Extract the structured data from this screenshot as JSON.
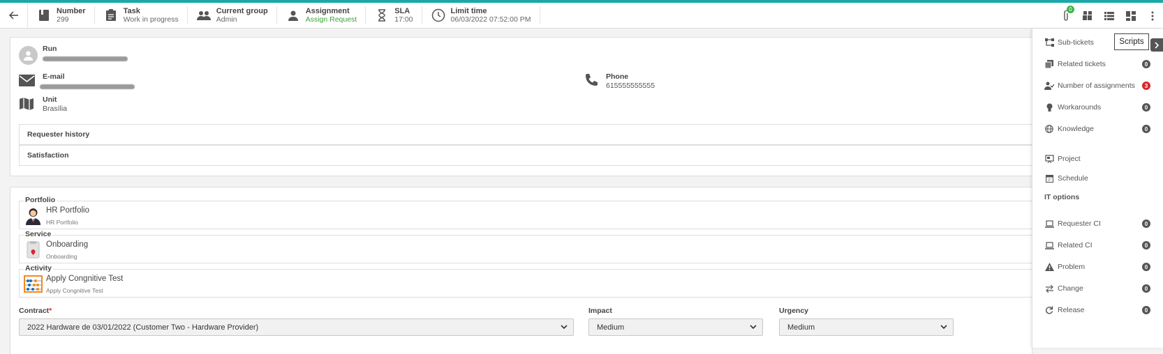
{
  "header": {
    "number_label": "Number",
    "number_value": "299",
    "task_label": "Task",
    "task_value": "Work in progress",
    "group_label": "Current group",
    "group_value": "Admin",
    "assignment_label": "Assignment",
    "assignment_value": "Assign Request",
    "sla_label": "SLA",
    "sla_value": "17:00",
    "limit_label": "Limit time",
    "limit_value": "06/03/2022 07:52:00 PM",
    "attachment_count": "0"
  },
  "requester": {
    "run_label": "Run",
    "email_label": "E-mail",
    "phone_label": "Phone",
    "phone_value": "615555555555",
    "unit_label": "Unit",
    "unit_value": "Brasília",
    "history_label": "Requester history",
    "satisfaction_label": "Satisfaction"
  },
  "catalog": {
    "portfolio_label": "Portfolio",
    "portfolio_name": "HR Portfolio",
    "portfolio_sub": "HR Portfolio",
    "service_label": "Service",
    "service_name": "Onboarding",
    "service_sub": "Onboarding",
    "activity_label": "Activity",
    "activity_name": "Apply Congnitive Test",
    "activity_sub": "Apply Congnitive Test"
  },
  "fields": {
    "contract_label": "Contract",
    "contract_required": "*",
    "contract_value": "2022 Hardware de 03/01/2022 (Customer Two - Hardware Provider)",
    "impact_label": "Impact",
    "impact_value": "Medium",
    "urgency_label": "Urgency",
    "urgency_value": "Medium"
  },
  "sidebar": {
    "tooltip": "Scripts",
    "items": [
      {
        "label": "Sub-tickets",
        "icon": "sub-tickets-icon"
      },
      {
        "label": "Related tickets",
        "count": "0",
        "icon": "related-tickets-icon"
      },
      {
        "label": "Number of assignments",
        "count": "3",
        "icon": "assignments-icon"
      },
      {
        "label": "Workarounds",
        "count": "0",
        "icon": "lightbulb-icon"
      },
      {
        "label": "Knowledge",
        "count": "0",
        "icon": "globe-icon"
      },
      {
        "label": "Project",
        "icon": "project-icon"
      },
      {
        "label": "Schedule",
        "icon": "calendar-icon"
      }
    ],
    "it_options_label": "IT options",
    "it_items": [
      {
        "label": "Requester CI",
        "count": "0",
        "icon": "laptop-icon"
      },
      {
        "label": "Related CI",
        "count": "0",
        "icon": "laptop-icon"
      },
      {
        "label": "Problem",
        "count": "0",
        "icon": "warning-icon"
      },
      {
        "label": "Change",
        "count": "0",
        "icon": "swap-icon"
      },
      {
        "label": "Release",
        "count": "0",
        "icon": "refresh-icon"
      }
    ]
  }
}
